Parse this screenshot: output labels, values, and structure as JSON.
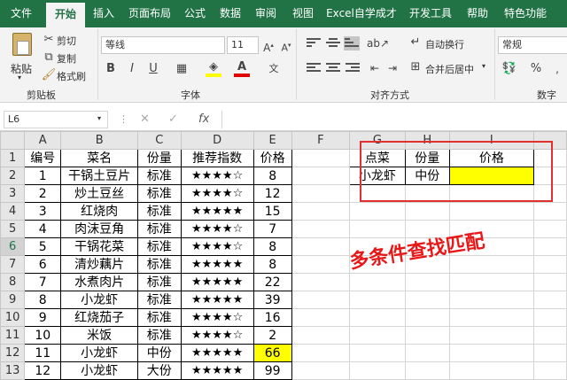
{
  "tabs": [
    "文件",
    "开始",
    "插入",
    "页面布局",
    "公式",
    "数据",
    "审阅",
    "视图",
    "Excel自学成才",
    "开发工具",
    "帮助",
    "特色功能"
  ],
  "ribbon": {
    "paste": "粘贴",
    "cut": "剪切",
    "copy": "复制",
    "format_painter": "格式刷",
    "clipboard_group": "剪贴板",
    "font_name": "等线",
    "font_size": "11",
    "font_group": "字体",
    "wrap_text": "自动换行",
    "merge_center": "合并后居中",
    "align_group": "对齐方式",
    "number_format": "常规",
    "number_group": "数字",
    "bold": "B",
    "italic": "I",
    "underline": "U",
    "font_color_letter": "A",
    "percent": "%"
  },
  "formula_bar": {
    "name_box": "L6",
    "fx": "fx",
    "formula": ""
  },
  "columns": [
    "A",
    "B",
    "C",
    "D",
    "E",
    "F",
    "G",
    "H",
    "I"
  ],
  "rows": [
    "1",
    "2",
    "3",
    "4",
    "5",
    "6",
    "7",
    "8",
    "9",
    "10",
    "11",
    "12",
    "13"
  ],
  "selected": {
    "column": "L",
    "row": "6"
  },
  "table": {
    "headers": [
      "编号",
      "菜名",
      "份量",
      "推荐指数",
      "价格"
    ],
    "rows": [
      [
        "1",
        "干锅土豆片",
        "标准",
        "★★★★☆",
        "8"
      ],
      [
        "2",
        "炒土豆丝",
        "标准",
        "★★★★☆",
        "12"
      ],
      [
        "3",
        "红烧肉",
        "标准",
        "★★★★★",
        "15"
      ],
      [
        "4",
        "肉沫豆角",
        "标准",
        "★★★★☆",
        "7"
      ],
      [
        "5",
        "干锅花菜",
        "标准",
        "★★★★☆",
        "8"
      ],
      [
        "6",
        "清炒藕片",
        "标准",
        "★★★★★",
        "8"
      ],
      [
        "7",
        "水煮肉片",
        "标准",
        "★★★★★",
        "22"
      ],
      [
        "8",
        "小龙虾",
        "标准",
        "★★★★★",
        "39"
      ],
      [
        "9",
        "红烧茄子",
        "标准",
        "★★★★☆",
        "16"
      ],
      [
        "10",
        "米饭",
        "标准",
        "★★★★☆",
        "2"
      ],
      [
        "11",
        "小龙虾",
        "中份",
        "★★★★★",
        "66"
      ],
      [
        "12",
        "小龙虾",
        "大份",
        "★★★★★",
        "99"
      ]
    ]
  },
  "lookup": {
    "headers": [
      "点菜",
      "份量",
      "价格"
    ],
    "values": [
      "小龙虾",
      "中份",
      ""
    ]
  },
  "annotation": "多条件查找匹配",
  "colors": {
    "accent": "#217346",
    "highlight": "#ffff00",
    "annotation": "#e81818"
  }
}
